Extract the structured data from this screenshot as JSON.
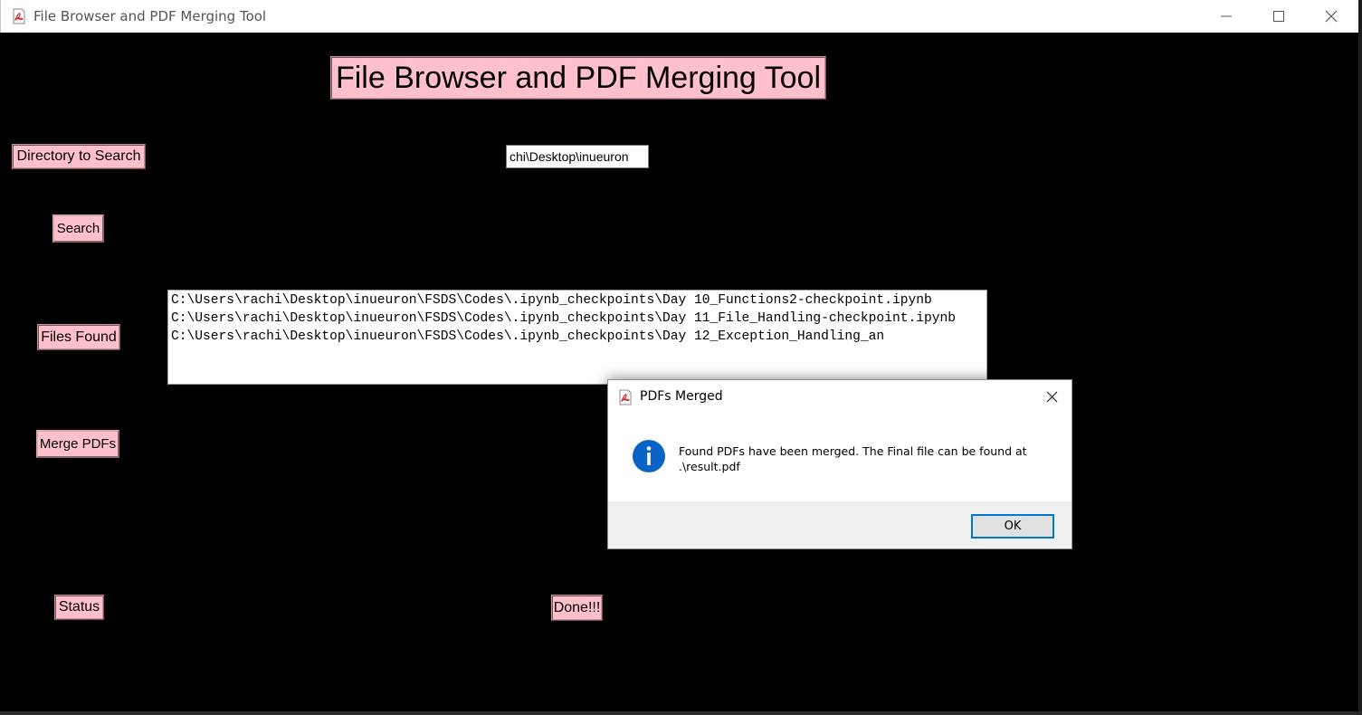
{
  "window": {
    "title": "File Browser and PDF Merging Tool"
  },
  "app": {
    "heading": "File Browser and PDF Merging Tool",
    "directory_label": "Directory to Search",
    "directory_value": "chi\\Desktop\\inueuron",
    "search_button": "Search",
    "files_label": "Files Found",
    "files_text": "C:\\Users\\rachi\\Desktop\\inueuron\\FSDS\\Codes\\.ipynb_checkpoints\\Day 10_Functions2-checkpoint.ipynb\nC:\\Users\\rachi\\Desktop\\inueuron\\FSDS\\Codes\\.ipynb_checkpoints\\Day 11_File_Handling-checkpoint.ipynb\nC:\\Users\\rachi\\Desktop\\inueuron\\FSDS\\Codes\\.ipynb_checkpoints\\Day 12_Exception_Handling_an",
    "merge_button": "Merge PDFs",
    "status_label": "Status",
    "status_value": "Done!!!"
  },
  "dialog": {
    "title": "PDFs Merged",
    "message_line1": "Found PDFs have been merged. The Final file can be found at",
    "message_line2": ".\\result.pdf",
    "ok_button": "OK",
    "icon": "info-icon"
  },
  "colors": {
    "background": "#000000",
    "label_bg": "#ffc0cb",
    "info_blue": "#0078d7"
  }
}
